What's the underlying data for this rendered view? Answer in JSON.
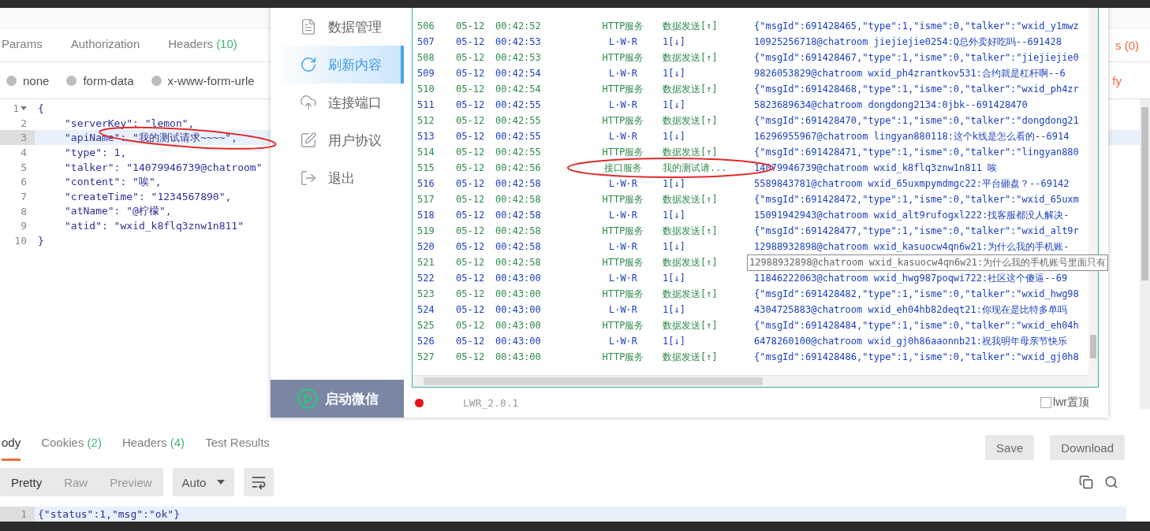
{
  "request_tabs": [
    {
      "label": "Params",
      "selected": false
    },
    {
      "label": "Authorization",
      "selected": false
    },
    {
      "label": "Headers",
      "count": "(10)",
      "selected": false
    }
  ],
  "request_tabs_tail": "s (0)",
  "body_types": [
    {
      "label": "none",
      "selected": false
    },
    {
      "label": "form-data",
      "selected": false
    },
    {
      "label": "x-www-form-urle",
      "selected": false
    }
  ],
  "beautify_link": "fy",
  "request_body": [
    {
      "number": "1",
      "text": "{",
      "highlighted": false,
      "expanded": true,
      "children": [
        {
          "number": "2",
          "text": "\"serverKey\": \"lemon\",",
          "highlighted": false
        },
        {
          "number": "3",
          "text": "\"apiName\": \"我的测试请求~~~~\",",
          "highlighted": true
        },
        {
          "number": "4",
          "text": "\"type\": 1,",
          "highlighted": false
        },
        {
          "number": "5",
          "text": "\"talker\": \"14079946739@chatroom\"",
          "highlighted": false
        },
        {
          "number": "6",
          "text": "\"content\": \"唉\",",
          "highlighted": false
        },
        {
          "number": "7",
          "text": "\"createTime\": \"1234567890\",",
          "highlighted": false
        },
        {
          "number": "8",
          "text": "\"atName\": \"@柠檬\",",
          "highlighted": false
        },
        {
          "number": "9",
          "text": "\"atid\": \"wxid_k8flq3znw1n811\"",
          "highlighted": false
        }
      ]
    },
    {
      "number": "10",
      "text": "}",
      "highlighted": false
    }
  ],
  "response_tabs": [
    {
      "label": "ody",
      "selected": true
    },
    {
      "label": "Cookies",
      "count": "(2)",
      "selected": false
    },
    {
      "label": "Headers",
      "count": "(4)",
      "selected": false
    },
    {
      "label": "Test Results",
      "selected": false
    }
  ],
  "response_buttons": [
    "Save",
    "Download"
  ],
  "view_modes": [
    {
      "label": "Pretty",
      "selected": true
    },
    {
      "label": "Raw",
      "selected": false
    },
    {
      "label": "Preview",
      "selected": false
    }
  ],
  "format_select": "Auto",
  "response_body": [
    {
      "number": "1",
      "text": "{\"status\":1,\"msg\":\"ok\"}",
      "highlighted": true
    }
  ],
  "app_window": {
    "nav": [
      {
        "label": "数据管理",
        "selected": false
      },
      {
        "label": "刷新内容",
        "selected": true
      },
      {
        "label": "连接端口",
        "selected": false
      },
      {
        "label": "用户协议",
        "selected": false
      },
      {
        "label": "退出",
        "selected": false
      }
    ],
    "start_button": "启动微信",
    "log": [
      {
        "no": "506",
        "date": "05-12",
        "time": "00:42:52",
        "source": "HTTP服务",
        "action": "数据发送[↑]",
        "content": "{\"msgId\":691428465,\"type\":1,\"isme\":0,\"talker\":\"wxid_y1mwz",
        "kind": "send"
      },
      {
        "no": "507",
        "date": "05-12",
        "time": "00:42:53",
        "source": "L·W·R",
        "action": "1[↓]",
        "content": "10925256718@chatroom jiejiejie0254:Q总外卖好吃吗--691428",
        "kind": "receive"
      },
      {
        "no": "508",
        "date": "05-12",
        "time": "00:42:53",
        "source": "HTTP服务",
        "action": "数据发送[↑]",
        "content": "{\"msgId\":691428467,\"type\":1,\"isme\":0,\"talker\":\"jiejiejie0",
        "kind": "send"
      },
      {
        "no": "509",
        "date": "05-12",
        "time": "00:42:54",
        "source": "L·W·R",
        "action": "1[↓]",
        "content": "9826053829@chatroom wxid_ph4zrantkov531:合约就是杠杆啊--6",
        "kind": "receive"
      },
      {
        "no": "510",
        "date": "05-12",
        "time": "00:42:54",
        "source": "HTTP服务",
        "action": "数据发送[↑]",
        "content": "{\"msgId\":691428468,\"type\":1,\"isme\":0,\"talker\":\"wxid_ph4zr",
        "kind": "send"
      },
      {
        "no": "511",
        "date": "05-12",
        "time": "00:42:55",
        "source": "L·W·R",
        "action": "1[↓]",
        "content": "5823689634@chatroom dongdong2134:0jbk--691428470",
        "kind": "receive"
      },
      {
        "no": "512",
        "date": "05-12",
        "time": "00:42:55",
        "source": "HTTP服务",
        "action": "数据发送[↑]",
        "content": "{\"msgId\":691428470,\"type\":1,\"isme\":0,\"talker\":\"dongdong21",
        "kind": "send"
      },
      {
        "no": "513",
        "date": "05-12",
        "time": "00:42:55",
        "source": "L·W·R",
        "action": "1[↓]",
        "content": "16296955967@chatroom lingyan880118:这个k线是怎么看的--6914",
        "kind": "receive"
      },
      {
        "no": "514",
        "date": "05-12",
        "time": "00:42:55",
        "source": "HTTP服务",
        "action": "数据发送[↑]",
        "content": "{\"msgId\":691428471,\"type\":1,\"isme\":0,\"talker\":\"lingyan880",
        "kind": "send"
      },
      {
        "no": "515",
        "date": "05-12",
        "time": "00:42:56",
        "source": "接口服务",
        "action": "我的测试请...",
        "content": "14079946739@chatroom wxid_k8flq3znw1n811 唉",
        "kind": "send"
      },
      {
        "no": "516",
        "date": "05-12",
        "time": "00:42:58",
        "source": "L·W·R",
        "action": "1[↓]",
        "content": "5589843781@chatroom wxid_65uxmpymdmgc22:平台砸盘？--69142",
        "kind": "receive"
      },
      {
        "no": "517",
        "date": "05-12",
        "time": "00:42:58",
        "source": "HTTP服务",
        "action": "数据发送[↑]",
        "content": "{\"msgId\":691428472,\"type\":1,\"isme\":0,\"talker\":\"wxid_65uxm",
        "kind": "send"
      },
      {
        "no": "518",
        "date": "05-12",
        "time": "00:42:58",
        "source": "L·W·R",
        "action": "1[↓]",
        "content": "15091942943@chatroom wxid_alt9rufogxl222:找客服都没人解决-",
        "kind": "receive"
      },
      {
        "no": "519",
        "date": "05-12",
        "time": "00:42:58",
        "source": "HTTP服务",
        "action": "数据发送[↑]",
        "content": "{\"msgId\":691428477,\"type\":1,\"isme\":0,\"talker\":\"wxid_alt9r",
        "kind": "send"
      },
      {
        "no": "520",
        "date": "05-12",
        "time": "00:42:58",
        "source": "L·W·R",
        "action": "1[↓]",
        "content": "12988932898@chatroom wxid_kasuocw4qn6w21:为什么我的手机账-",
        "kind": "receive"
      },
      {
        "no": "521",
        "date": "05-12",
        "time": "00:42:58",
        "source": "HTTP服务",
        "action": "数据发送[↑]",
        "kind": "send"
      },
      {
        "no": "522",
        "date": "05-12",
        "time": "00:43:00",
        "source": "L·W·R",
        "action": "1[↓]",
        "content": "11846222063@chatroom wxid_hwg987poqwi722:社区这个傻逼--69",
        "kind": "receive"
      },
      {
        "no": "523",
        "date": "05-12",
        "time": "00:43:00",
        "source": "HTTP服务",
        "action": "数据发送[↑]",
        "content": "{\"msgId\":691428482,\"type\":1,\"isme\":0,\"talker\":\"wxid_hwg98",
        "kind": "send"
      },
      {
        "no": "524",
        "date": "05-12",
        "time": "00:43:00",
        "source": "L·W·R",
        "action": "1[↓]",
        "content": "4304725883@chatroom wxid_eh04hb82deqt21:你现在是比特多单吗",
        "kind": "receive"
      },
      {
        "no": "525",
        "date": "05-12",
        "time": "00:43:00",
        "source": "HTTP服务",
        "action": "数据发送[↑]",
        "content": "{\"msgId\":691428484,\"type\":1,\"isme\":0,\"talker\":\"wxid_eh04h",
        "kind": "send"
      },
      {
        "no": "526",
        "date": "05-12",
        "time": "00:43:00",
        "source": "L·W·R",
        "action": "1[↓]",
        "content": "6478260100@chatroom wxid_gj0h86aaonnb21:祝我明年母亲节快乐",
        "kind": "receive"
      },
      {
        "no": "527",
        "date": "05-12",
        "time": "00:43:00",
        "source": "HTTP服务",
        "action": "数据发送[↑]",
        "content": "{\"msgId\":691428486,\"type\":1,\"isme\":0,\"talker\":\"wxid_gj0h8",
        "kind": "send"
      }
    ],
    "tooltip": "12988932898@chatroom wxid_kasuocw4qn6w21:为什么我的手机账号里面只有",
    "status_dot": {
      "color": "#e8141b"
    },
    "version": "LWR_2.0.1",
    "pin_checkbox": {
      "label": "lwr置顶",
      "checked": false
    }
  }
}
